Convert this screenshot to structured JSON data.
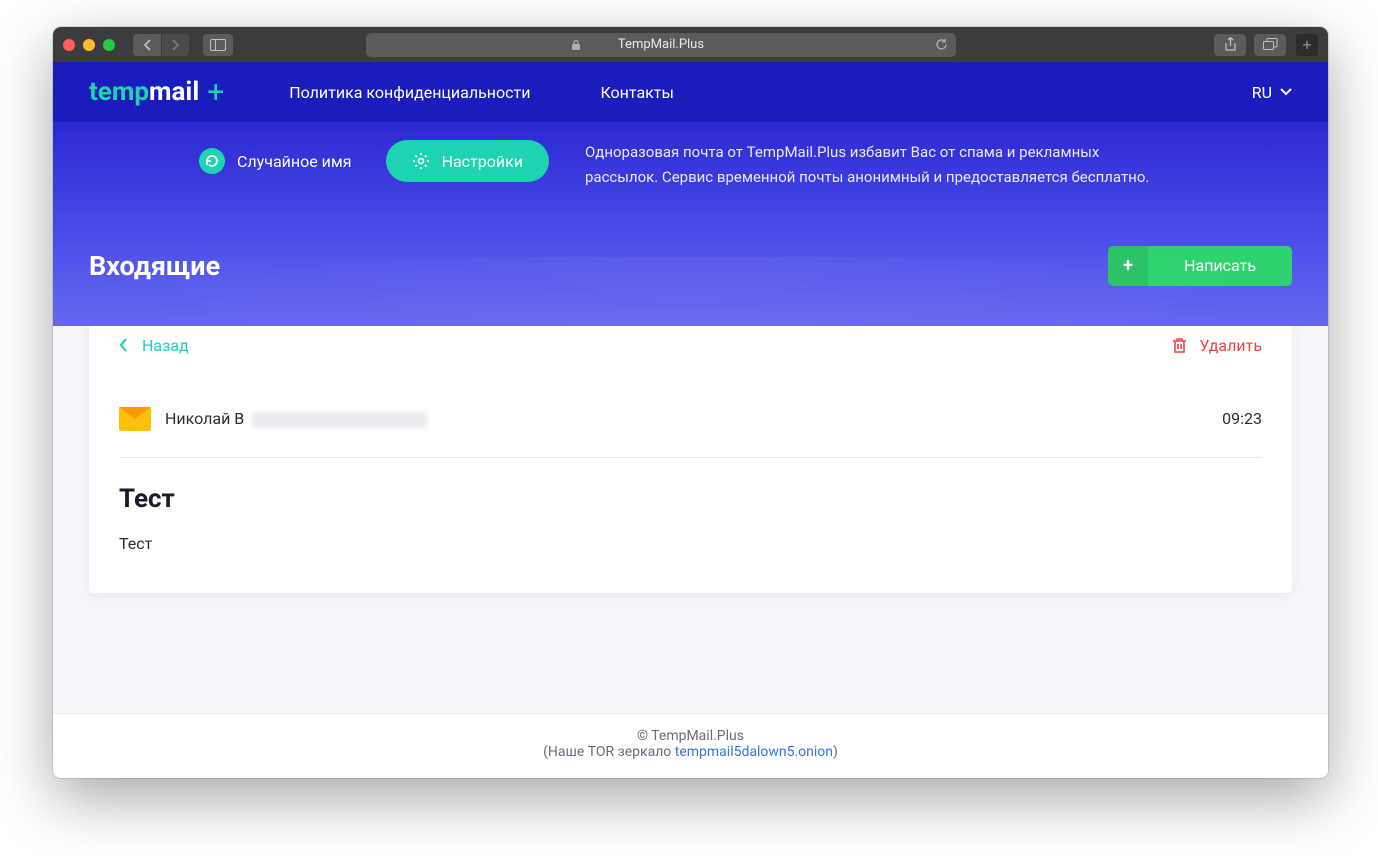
{
  "browser": {
    "address": "TempMail.Plus"
  },
  "nav": {
    "logo_temp": "temp",
    "logo_mail": "mail",
    "logo_plus": "+",
    "privacy": "Политика конфиденциальности",
    "contacts": "Контакты",
    "language": "RU"
  },
  "hero": {
    "random_name": "Случайное имя",
    "settings": "Настройки",
    "description": "Одноразовая почта от TempMail.Plus избавит Вас от спама и рекламных рассылок. Сервис временной почты анонимный и предоставляется бесплатно."
  },
  "inbox": {
    "title": "Входящие",
    "compose": "Написать"
  },
  "message": {
    "back": "Назад",
    "delete": "Удалить",
    "sender": "Николай В",
    "time": "09:23",
    "subject": "Тест",
    "body": "Тест"
  },
  "footer": {
    "copyright": "© TempMail.Plus",
    "mirror_prefix": "(Наше TOR зеркало ",
    "mirror_link": "tempmail5dalown5.onion",
    "mirror_suffix": ")"
  }
}
